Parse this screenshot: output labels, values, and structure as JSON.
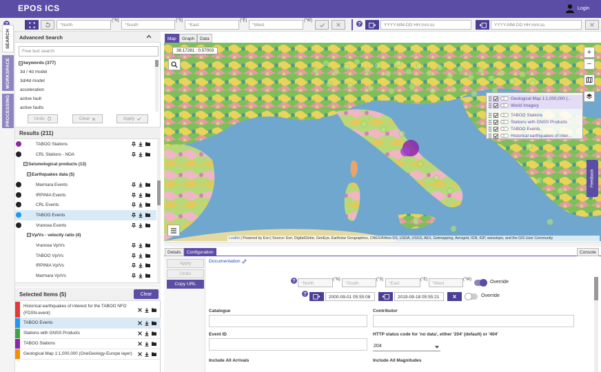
{
  "app": {
    "title": "EPOS ICS",
    "login_label": "Login"
  },
  "search_bar": {
    "north_placeholder": "North",
    "south_placeholder": "South",
    "east_placeholder": "East",
    "west_placeholder": "West",
    "north_sup": "(°N)",
    "south_sup": "(°S)",
    "east_sup": "(°E)",
    "west_sup": "(°W)",
    "date_start_placeholder": "YYYY-MM-DD HH:mm:ss",
    "date_end_placeholder": "YYYY-MM-DD HH:mm:ss"
  },
  "left_tabs": [
    "SEARCH",
    "WORKSPACE",
    "PROCESSING"
  ],
  "advanced_search": {
    "title": "Advanced Search",
    "free_text_placeholder": "Free text search",
    "keywords_header": "keywords (377)",
    "keywords": [
      "3d / 4d model",
      "3d/4d model",
      "acceleration",
      "active fault",
      "active faults"
    ],
    "undo_label": "Undo",
    "clear_label": "Clear",
    "apply_label": "Apply"
  },
  "results": {
    "title": "Results (211)",
    "items": [
      {
        "label": "TABOO Stations",
        "type": "item",
        "color": "#8e24aa"
      },
      {
        "label": "CRL Stations - NOA",
        "type": "item",
        "color": "#222222"
      },
      {
        "label": "Seismological products (13)",
        "type": "group"
      },
      {
        "label": "Earthquakes data (5)",
        "type": "subgroup"
      },
      {
        "label": "Marmara Events",
        "type": "item",
        "color": "#222222"
      },
      {
        "label": "IRPINIA Events",
        "type": "item",
        "color": "#222222"
      },
      {
        "label": "CRL Events",
        "type": "item",
        "color": "#222222"
      },
      {
        "label": "TABOO Events",
        "type": "item",
        "color": "#2196f3",
        "selected": true
      },
      {
        "label": "Vrancea Events",
        "type": "item",
        "color": "#222222"
      },
      {
        "label": "Vp/Vs - velocity ratio (4)",
        "type": "subgroup"
      },
      {
        "label": "Vrancea Vp/Vs",
        "type": "item"
      },
      {
        "label": "TABOO Vp/Vs",
        "type": "item"
      },
      {
        "label": "IRPINIA Vp/Vs",
        "type": "item"
      },
      {
        "label": "Marmara Vp/Vs",
        "type": "item"
      }
    ]
  },
  "selected": {
    "title": "Selected Items (5)",
    "clear_label": "Clear",
    "items": [
      {
        "label": "Historical earthquakes of interest for the TABOO NFO",
        "label2": "(FDSN-event)",
        "color": "#e53935"
      },
      {
        "label": "TABOO Events",
        "color": "#2196f3"
      },
      {
        "label": "Stations with GNSS Products",
        "color": "#43a047"
      },
      {
        "label": "TABOO Stations",
        "color": "#8e24aa"
      },
      {
        "label": "Geological Map 1:1,000,000 (OneGeology-Europe layer)",
        "color": "#fb8c00"
      }
    ]
  },
  "map_tabs": [
    "Map",
    "Graph",
    "Data"
  ],
  "map": {
    "coords": "38.17281 : 0.57003",
    "zoom_in": "+",
    "zoom_out": "−",
    "legend": [
      "Geological Map 1:1,000,000 (...",
      "World Imagery",
      "TABOO Stations",
      "Stations with GNSS Products",
      "TABOO Events",
      "Historical earthquakes of inter..."
    ],
    "feedback": "Feedback",
    "attribution_leaflet": "Leaflet",
    "attribution_text": "| Powered by Esri | Source: Esri, DigitalGlobe, GeoEye, Earthstar Geographics, CNES/Airbus DS, USDA, USGS, AEX, Getmapping, Aerogrid, IGN, IGP, swisstopo, and the GIS User Community"
  },
  "bottom_tabs": {
    "details": "Details",
    "configuration": "Configuration",
    "console": "Console"
  },
  "config": {
    "apply_label": "Apply",
    "undo_label": "Undo",
    "copy_url_label": "Copy URL",
    "documentation_label": "Documentation",
    "override_label": "Override",
    "date_start": "2000-09-01 05:55:08",
    "date_end": "2019-09-18 05:55:21",
    "fields": {
      "catalogue": "Catalogue",
      "contributor": "Contributor",
      "event_id": "Event ID",
      "http_status": "HTTP status code for 'no data', either '204' (default) or '404'",
      "http_status_value": "204",
      "include_all_arrivals": "Include All Arrivals",
      "include_all_magnitudes": "Include All Magnitudes"
    }
  }
}
